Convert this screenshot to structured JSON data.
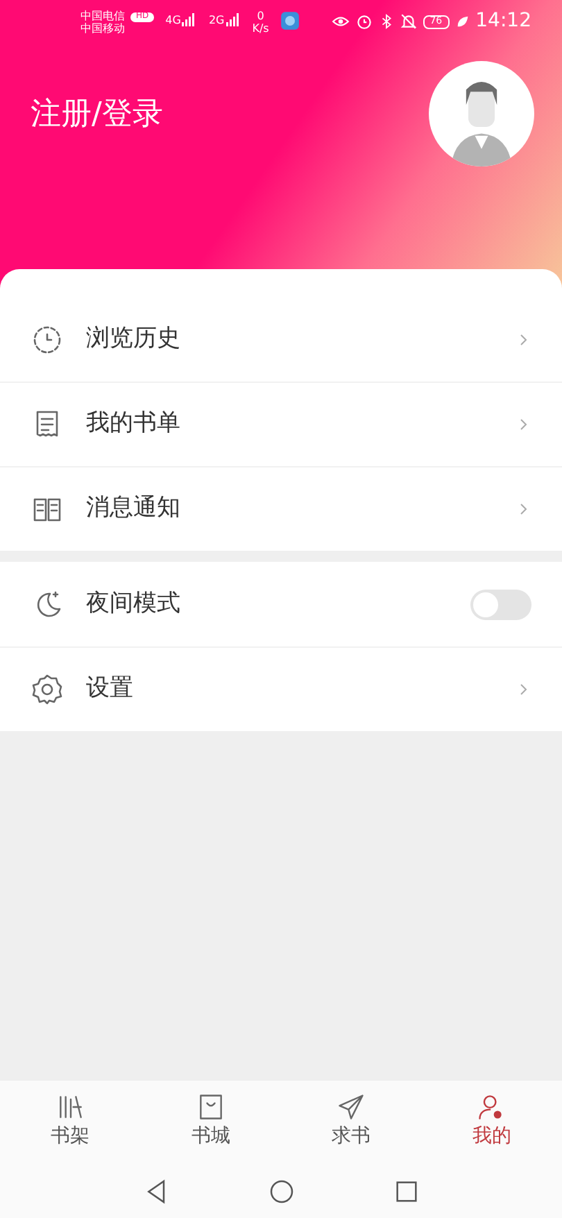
{
  "status_bar": {
    "carrier_1": "中国电信",
    "carrier_1_badge": "HD",
    "carrier_2": "中国移动",
    "network_1": "4G",
    "network_2": "2G",
    "speed": "0",
    "speed_unit": "K/s",
    "battery": "76",
    "time": "14:12"
  },
  "header": {
    "login": "注册/登录"
  },
  "menu_groups": [
    {
      "items": [
        {
          "kind": "link",
          "label": "浏览历史"
        },
        {
          "kind": "link",
          "label": "我的书单"
        },
        {
          "kind": "link",
          "label": "消息通知"
        }
      ]
    },
    {
      "items": [
        {
          "kind": "toggle",
          "label": "夜间模式",
          "on": false
        },
        {
          "kind": "link",
          "label": "设置"
        }
      ]
    }
  ],
  "tab_bar": [
    {
      "label": "书架",
      "selected": false
    },
    {
      "label": "书城",
      "selected": false
    },
    {
      "label": "求书",
      "selected": false
    },
    {
      "label": "我的",
      "selected": true
    }
  ]
}
